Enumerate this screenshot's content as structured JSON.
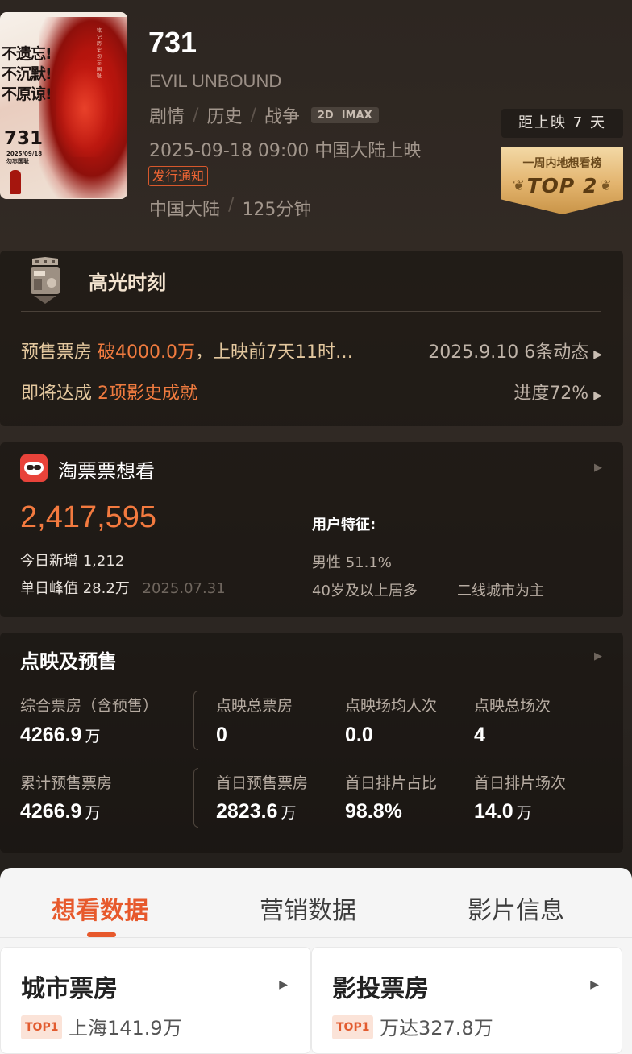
{
  "poster": {
    "slogan_1": "不遗忘!",
    "slogan_2": "不沉默!",
    "slogan_3": "不原谅!",
    "number": "731",
    "date": "2025/09/18",
    "tagline": "勿忘国耻",
    "vertical_text": "铭记历史 勿忘国耻"
  },
  "movie": {
    "title": "731",
    "english_title": "EVIL UNBOUND",
    "genres": [
      "剧情",
      "历史",
      "战争"
    ],
    "formats": [
      "2D",
      "IMAX"
    ],
    "release": "2025-09-18 09:00 中国大陆上映",
    "notice_tag": "发行通知",
    "region": "中国大陆",
    "duration": "125分钟"
  },
  "countdown": "距上映 7 天",
  "rank_badge": {
    "label": "一周内地想看榜",
    "rank": "TOP 2"
  },
  "highlights": {
    "title": "高光时刻",
    "row1_prefix": "预售票房 ",
    "row1_highlight": "破4000.0万",
    "row1_suffix": "，上映前7天11时…",
    "row1_right": "2025.9.10 6条动态",
    "row2_prefix": "即将达成 ",
    "row2_highlight": "2项影史成就",
    "row2_right": "进度72%"
  },
  "want": {
    "title": "淘票票想看",
    "count": "2,417,595",
    "today_label": "今日新增",
    "today_value": "1,212",
    "peak_label": "单日峰值",
    "peak_value": "28.2万",
    "peak_date": "2025.07.31",
    "traits_title": "用户特征:",
    "gender": "男性 51.1%",
    "age": "40岁及以上居多",
    "city": "二线城市为主"
  },
  "presale": {
    "title": "点映及预售",
    "metrics": [
      {
        "label": "综合票房（含预售）",
        "value": "4266.9",
        "unit": "万"
      },
      {
        "label": "点映总票房",
        "value": "0",
        "unit": ""
      },
      {
        "label": "点映场均人次",
        "value": "0.0",
        "unit": ""
      },
      {
        "label": "点映总场次",
        "value": "4",
        "unit": ""
      },
      {
        "label": "累计预售票房",
        "value": "4266.9",
        "unit": "万"
      },
      {
        "label": "首日预售票房",
        "value": "2823.6",
        "unit": "万"
      },
      {
        "label": "首日排片占比",
        "value": "98.8%",
        "unit": ""
      },
      {
        "label": "首日排片场次",
        "value": "14.0",
        "unit": "万"
      }
    ]
  },
  "tabs": [
    "想看数据",
    "营销数据",
    "影片信息"
  ],
  "sub_cards": [
    {
      "title": "城市票房",
      "tag": "TOP1",
      "value": "上海141.9万"
    },
    {
      "title": "影投票房",
      "tag": "TOP1",
      "value": "万达327.8万"
    }
  ]
}
